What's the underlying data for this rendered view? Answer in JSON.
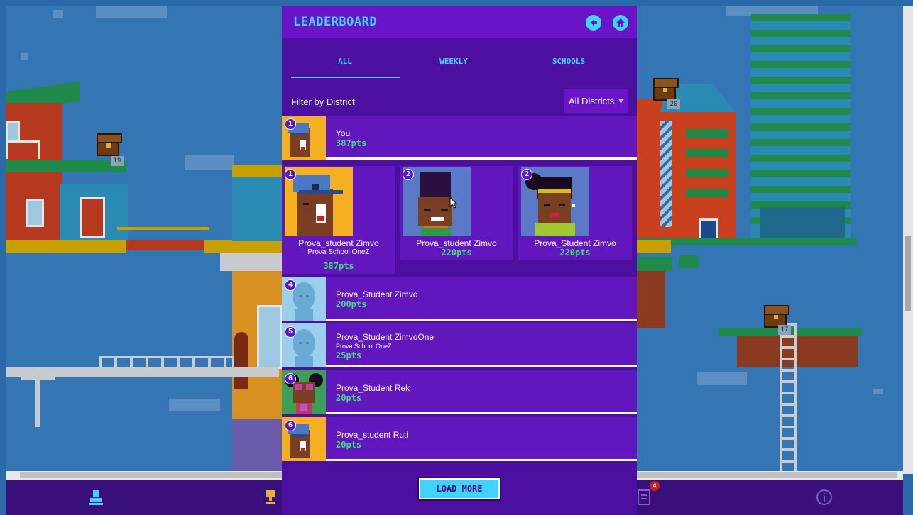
{
  "panel": {
    "title": "LEADERBOARD",
    "back_icon": "arrow-left-icon",
    "home_icon": "home-icon",
    "tabs": [
      {
        "label": "ALL",
        "active": true
      },
      {
        "label": "WEEKLY",
        "active": false
      },
      {
        "label": "SCHOOLS",
        "active": false
      }
    ],
    "filter": {
      "label": "Filter by District",
      "selected": "All Districts"
    }
  },
  "you": {
    "rank": "1",
    "name": "You",
    "points": "387pts"
  },
  "podium": [
    {
      "rank": "1",
      "name": "Prova_student Zimvo",
      "school": "Prova School OneZ",
      "points": "387pts"
    },
    {
      "rank": "2",
      "name": "Prova_student Zimvo",
      "school": "",
      "points": "220pts"
    },
    {
      "rank": "2",
      "name": "Prova_Student Zimvo",
      "school": "",
      "points": "220pts"
    }
  ],
  "rows": [
    {
      "rank": "4",
      "name": "Prova_Student Zimvo",
      "school": "",
      "points": "200pts"
    },
    {
      "rank": "5",
      "name": "Prova_Student ZimvoOne",
      "school": "Prova School OneZ",
      "points": "25pts"
    },
    {
      "rank": "6",
      "name": "Prova_Student Rek",
      "school": "",
      "points": "20pts"
    },
    {
      "rank": "6",
      "name": "Prova_student Ruti",
      "school": "",
      "points": "20pts"
    }
  ],
  "load_more": "LOAD MORE",
  "world": {
    "chests": [
      {
        "count": "19"
      },
      {
        "count": "20"
      },
      {
        "count": "17"
      }
    ]
  },
  "bottom_nav": {
    "items": [
      {
        "icon": "profile-icon"
      },
      {
        "icon": "trophy-icon"
      },
      {
        "icon": "tasks-icon",
        "badge": "4"
      },
      {
        "icon": "info-icon"
      }
    ]
  },
  "colors": {
    "panel_bg": "#4d0f9f",
    "row_bg": "#6216bd",
    "header_bg": "#6a14c8",
    "accent_cyan": "#3fd4ff",
    "points_green": "#3de07a"
  }
}
